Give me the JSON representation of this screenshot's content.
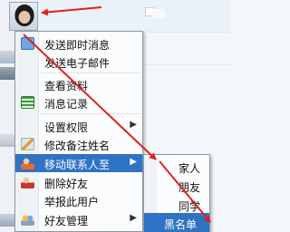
{
  "menu": {
    "items": [
      {
        "label": "发送即时消息",
        "icon": "chat-icon"
      },
      {
        "label": "发送电子邮件",
        "icon": ""
      },
      {
        "label": "查看资料",
        "icon": ""
      },
      {
        "label": "消息记录",
        "icon": "list-icon"
      },
      {
        "label": "设置权限",
        "icon": "",
        "submenu": true
      },
      {
        "label": "修改备注姓名",
        "icon": "edit-icon"
      },
      {
        "label": "移动联系人至",
        "icon": "move-contact-icon",
        "submenu": true,
        "highlighted": true
      },
      {
        "label": "删除好友",
        "icon": "delete-contact-icon"
      },
      {
        "label": "举报此用户",
        "icon": ""
      },
      {
        "label": "好友管理",
        "icon": "manage-contacts-icon",
        "submenu": true
      }
    ],
    "arrow_glyph": "▶"
  },
  "submenu": {
    "items": [
      {
        "label": "家人"
      },
      {
        "label": "朋友"
      },
      {
        "label": "同学"
      },
      {
        "label": "黑名单",
        "highlighted": true
      }
    ]
  },
  "colors": {
    "highlight": "#2f73c5",
    "annotation_arrow": "#e02020"
  }
}
